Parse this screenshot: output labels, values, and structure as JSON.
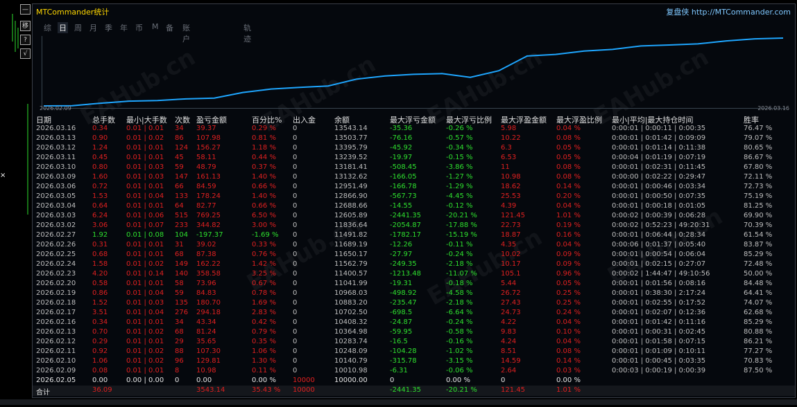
{
  "window": {
    "title": "MTCommander统计",
    "brand_prefix": "复盘侠",
    "brand_url": "http://MTCommander.com"
  },
  "left_buttons": [
    "—",
    "移",
    "?",
    "√"
  ],
  "left_edge_x": "×",
  "tabs": [
    {
      "label": "综",
      "active": false
    },
    {
      "label": "日",
      "active": true
    },
    {
      "label": "周",
      "active": false
    },
    {
      "label": "月",
      "active": false
    },
    {
      "label": "季",
      "active": false
    },
    {
      "label": "年",
      "active": false
    },
    {
      "label": "币",
      "active": false
    },
    {
      "label": "M",
      "active": false
    },
    {
      "label": "备",
      "active": false
    },
    {
      "label": "账户",
      "active": false
    },
    {
      "label": "轨迹",
      "active": false
    }
  ],
  "chart_dates": {
    "start": "2026.02.09",
    "end": "2026.03.16"
  },
  "chart_data": {
    "type": "line",
    "x": [
      "2026.02.05",
      "2026.02.09",
      "2026.02.10",
      "2026.02.11",
      "2026.02.12",
      "2026.02.13",
      "2026.02.16",
      "2026.02.17",
      "2026.02.18",
      "2026.02.19",
      "2026.02.20",
      "2026.02.23",
      "2026.02.24",
      "2026.02.25",
      "2026.02.26",
      "2026.02.27",
      "2026.03.02",
      "2026.03.03",
      "2026.03.04",
      "2026.03.05",
      "2026.03.06",
      "2026.03.09",
      "2026.03.10",
      "2026.03.11",
      "2026.03.12",
      "2026.03.13",
      "2026.03.16"
    ],
    "values": [
      10000.0,
      10010.98,
      10140.79,
      10248.09,
      10283.74,
      10364.98,
      10408.32,
      10702.5,
      10883.2,
      10968.03,
      11041.99,
      11400.57,
      11562.79,
      11650.17,
      11689.19,
      11491.82,
      11836.64,
      12605.89,
      12688.66,
      12866.9,
      12951.49,
      13132.62,
      13181.41,
      13239.52,
      13395.79,
      13503.77,
      13543.14
    ]
  },
  "headers": [
    "日期",
    "总手数",
    "最小|大手数",
    "次数",
    "盈亏金额",
    "百分比%",
    "出入金",
    "余额",
    "最大浮亏金额",
    "最大浮亏比例",
    "最大浮盈金额",
    "最大浮盈比例",
    "最小|平均|最大持仓时间",
    "胜率"
  ],
  "rows": [
    [
      "2026.03.16",
      "0.34",
      "0.01 | 0.01",
      "34",
      "39.37",
      "0.29 %",
      "0",
      "13543.14",
      "-35.36",
      "-0.26 %",
      "5.98",
      "0.04 %",
      "0:00:01 | 0:00:11 | 0:00:35",
      "76.47 %"
    ],
    [
      "2026.03.13",
      "0.90",
      "0.01 | 0.02",
      "86",
      "107.98",
      "0.81 %",
      "0",
      "13503.77",
      "-76.16",
      "-0.57 %",
      "10.22",
      "0.08 %",
      "0:00:01 | 0:01:42 | 0:09:09",
      "79.07 %"
    ],
    [
      "2026.03.12",
      "1.24",
      "0.01 | 0.01",
      "124",
      "156.27",
      "1.18 %",
      "0",
      "13395.79",
      "-45.92",
      "-0.34 %",
      "6.3",
      "0.05 %",
      "0:00:01 | 0:01:14 | 0:11:38",
      "80.65 %"
    ],
    [
      "2026.03.11",
      "0.45",
      "0.01 | 0.01",
      "45",
      "58.11",
      "0.44 %",
      "0",
      "13239.52",
      "-19.97",
      "-0.15 %",
      "6.53",
      "0.05 %",
      "0:00:04 | 0:01:19 | 0:07:19",
      "86.67 %"
    ],
    [
      "2026.03.10",
      "0.80",
      "0.01 | 0.03",
      "59",
      "48.79",
      "0.37 %",
      "0",
      "13181.41",
      "-508.45",
      "-3.86 %",
      "11",
      "0.08 %",
      "0:00:01 | 0:02:31 | 0:11:45",
      "67.80 %"
    ],
    [
      "2026.03.09",
      "1.60",
      "0.01 | 0.03",
      "147",
      "161.13",
      "1.40 %",
      "0",
      "13132.62",
      "-166.05",
      "-1.27 %",
      "10.98",
      "0.08 %",
      "0:00:00 | 0:02:22 | 0:29:47",
      "72.11 %"
    ],
    [
      "2026.03.06",
      "0.72",
      "0.01 | 0.01",
      "66",
      "84.59",
      "0.66 %",
      "0",
      "12951.49",
      "-166.78",
      "-1.29 %",
      "18.62",
      "0.14 %",
      "0:00:01 | 0:00:46 | 0:03:34",
      "72.73 %"
    ],
    [
      "2026.03.05",
      "1.53",
      "0.01 | 0.04",
      "133",
      "178.24",
      "1.40 %",
      "0",
      "12866.90",
      "-567.73",
      "-4.45 %",
      "25.53",
      "0.20 %",
      "0:00:01 | 0:00:50 | 0:07:35",
      "75.19 %"
    ],
    [
      "2026.03.04",
      "0.64",
      "0.01 | 0.01",
      "64",
      "82.77",
      "0.66 %",
      "0",
      "12688.66",
      "-14.55",
      "-0.12 %",
      "4.39",
      "0.04 %",
      "0:00:01 | 0:00:18 | 0:01:05",
      "81.25 %"
    ],
    [
      "2026.03.03",
      "6.24",
      "0.01 | 0.06",
      "515",
      "769.25",
      "6.50 %",
      "0",
      "12605.89",
      "-2441.35",
      "-20.21 %",
      "121.45",
      "1.01 %",
      "0:00:02 | 0:00:39 | 0:06:28",
      "69.90 %"
    ],
    [
      "2026.03.02",
      "3.06",
      "0.01 | 0.07",
      "233",
      "344.82",
      "3.00 %",
      "0",
      "11836.64",
      "-2054.87",
      "-17.88 %",
      "22.73",
      "0.19 %",
      "0:00:02 | 0:52:23 | 49:20:31",
      "70.39 %"
    ],
    [
      "2026.02.27",
      "1.92",
      "0.01 | 0.08",
      "104",
      "-197.37",
      "-1.69 %",
      "0",
      "11491.82",
      "-1782.17",
      "-15.19 %",
      "18.87",
      "0.16 %",
      "0:00:01 | 0:06:44 | 0:28:34",
      "61.54 %"
    ],
    [
      "2026.02.26",
      "0.31",
      "0.01 | 0.01",
      "31",
      "39.02",
      "0.33 %",
      "0",
      "11689.19",
      "-12.26",
      "-0.11 %",
      "4.35",
      "0.04 %",
      "0:00:06 | 0:01:37 | 0:05:40",
      "83.87 %"
    ],
    [
      "2026.02.25",
      "0.68",
      "0.01 | 0.01",
      "68",
      "87.38",
      "0.76 %",
      "0",
      "11650.17",
      "-27.97",
      "-0.24 %",
      "10.02",
      "0.09 %",
      "0:00:01 | 0:00:54 | 0:06:04",
      "85.29 %"
    ],
    [
      "2026.02.24",
      "1.58",
      "0.01 | 0.02",
      "149",
      "162.22",
      "1.42 %",
      "0",
      "11562.79",
      "-249.35",
      "-2.18 %",
      "10.17",
      "0.09 %",
      "0:00:01 | 0:02:15 | 0:27:07",
      "72.48 %"
    ],
    [
      "2026.02.23",
      "4.20",
      "0.01 | 0.14",
      "140",
      "358.58",
      "3.25 %",
      "0",
      "11400.57",
      "-1213.48",
      "-11.07 %",
      "105.1",
      "0.96 %",
      "0:00:02 | 1:44:47 | 49:10:56",
      "50.00 %"
    ],
    [
      "2026.02.20",
      "0.58",
      "0.01 | 0.01",
      "58",
      "73.96",
      "0.67 %",
      "0",
      "11041.99",
      "-19.31",
      "-0.18 %",
      "5.44",
      "0.05 %",
      "0:00:01 | 0:01:56 | 0:08:16",
      "84.48 %"
    ],
    [
      "2026.02.19",
      "0.86",
      "0.01 | 0.04",
      "59",
      "84.83",
      "0.78 %",
      "0",
      "10968.03",
      "-498.92",
      "-4.58 %",
      "26.72",
      "0.25 %",
      "0:00:01 | 0:38:30 | 2:17:24",
      "64.41 %"
    ],
    [
      "2026.02.18",
      "1.52",
      "0.01 | 0.03",
      "135",
      "180.70",
      "1.69 %",
      "0",
      "10883.20",
      "-235.47",
      "-2.18 %",
      "27.43",
      "0.25 %",
      "0:00:01 | 0:02:55 | 0:17:52",
      "74.07 %"
    ],
    [
      "2026.02.17",
      "3.51",
      "0.01 | 0.04",
      "276",
      "294.18",
      "2.83 %",
      "0",
      "10702.50",
      "-698.5",
      "-6.64 %",
      "24.73",
      "0.24 %",
      "0:00:01 | 0:02:07 | 0:12:36",
      "62.68 %"
    ],
    [
      "2026.02.16",
      "0.34",
      "0.01 | 0.01",
      "34",
      "43.34",
      "0.42 %",
      "0",
      "10408.32",
      "-24.87",
      "-0.24 %",
      "4.22",
      "0.04 %",
      "0:00:01 | 0:01:42 | 0:11:16",
      "85.29 %"
    ],
    [
      "2026.02.13",
      "0.70",
      "0.01 | 0.02",
      "68",
      "81.24",
      "0.79 %",
      "0",
      "10364.98",
      "-59.95",
      "-0.58 %",
      "9.83",
      "0.10 %",
      "0:00:01 | 0:00:31 | 0:02:45",
      "80.88 %"
    ],
    [
      "2026.02.12",
      "0.29",
      "0.01 | 0.01",
      "29",
      "35.65",
      "0.35 %",
      "0",
      "10283.74",
      "-16.5",
      "-0.16 %",
      "4.24",
      "0.04 %",
      "0:00:01 | 0:01:58 | 0:07:15",
      "86.21 %"
    ],
    [
      "2026.02.11",
      "0.92",
      "0.01 | 0.02",
      "88",
      "107.30",
      "1.06 %",
      "0",
      "10248.09",
      "-104.28",
      "-1.02 %",
      "8.51",
      "0.08 %",
      "0:00:01 | 0:01:09 | 0:10:11",
      "77.27 %"
    ],
    [
      "2026.02.10",
      "1.06",
      "0.01 | 0.02",
      "96",
      "129.81",
      "1.30 %",
      "0",
      "10140.79",
      "-315.78",
      "-3.15 %",
      "14.59",
      "0.14 %",
      "0:00:01 | 0:00:45 | 0:03:35",
      "70.83 %"
    ],
    [
      "2026.02.09",
      "0.08",
      "0.01 | 0.01",
      "8",
      "10.98",
      "0.11 %",
      "0",
      "10010.98",
      "-6.31",
      "-0.06 %",
      "2.64",
      "0.03 %",
      "0:00:03 | 0:00:19 | 0:00:39",
      "87.50 %"
    ],
    [
      "2026.02.05",
      "0.00",
      "0.00 | 0.00",
      "0",
      "0.00",
      "0.00 %",
      "10000",
      "10000.00",
      "0",
      "0.00 %",
      "0",
      "0.00 %",
      "",
      ""
    ]
  ],
  "footer": [
    "合计",
    "36.09",
    "",
    "",
    "3543.14",
    "35.43 %",
    "10000",
    "",
    "-2441.35",
    "-20.21 %",
    "121.45",
    "1.01 %",
    "",
    ""
  ],
  "colors": {
    "title": "#ffd700",
    "brand": "#7fc8ff",
    "line": "#1ea6ff",
    "loss": "#e02020",
    "gain": "#2ee02e"
  }
}
